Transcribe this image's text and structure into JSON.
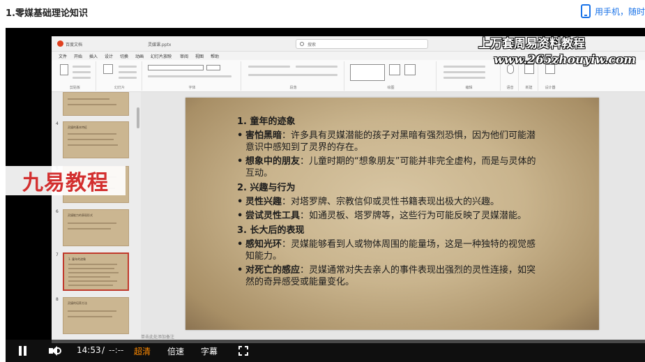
{
  "header": {
    "course_title": "1.零媒基础理论知识",
    "mobile_link": "用手机，随时"
  },
  "ppt": {
    "app_name": "百度文档",
    "file_name": "灵媒课.pptx",
    "search_placeholder": "搜索",
    "menu": [
      "文件",
      "开始",
      "插入",
      "设计",
      "切换",
      "动画",
      "幻灯片放映",
      "审阅",
      "视图",
      "帮助"
    ],
    "ribbon_groups": [
      "剪贴板",
      "幻灯片",
      "字体",
      "段落",
      "绘图",
      "编辑",
      "语音",
      "新建",
      "设计器"
    ],
    "thumbnails": [
      {
        "num": "",
        "title": ""
      },
      {
        "num": "4",
        "title": "灵媒的基本特征"
      },
      {
        "num": "5",
        "title": ""
      },
      {
        "num": "6",
        "title": "灵媒能力的表现形式"
      },
      {
        "num": "7",
        "title": "1. 童年的迹象"
      },
      {
        "num": "8",
        "title": "灵媒的培养方法"
      }
    ],
    "notes_stub": "单击此处添加备注"
  },
  "slide": {
    "sections": [
      {
        "heading": "1. 童年的迹象",
        "bullets": [
          {
            "label": "害怕黑暗",
            "text": "：许多具有灵媒潜能的孩子对黑暗有强烈恐惧，因为他们可能潜意识中感知到了灵界的存在。"
          },
          {
            "label": "想象中的朋友",
            "text": "：儿童时期的“想象朋友”可能并非完全虚构，而是与灵体的互动。"
          }
        ]
      },
      {
        "heading": "2. 兴趣与行为",
        "bullets": [
          {
            "label": "灵性兴趣",
            "text": "：对塔罗牌、宗教信仰或灵性书籍表现出极大的兴趣。"
          },
          {
            "label": "尝试灵性工具",
            "text": "：如通灵板、塔罗牌等，这些行为可能反映了灵媒潜能。"
          }
        ]
      },
      {
        "heading": "3. 长大后的表现",
        "bullets": [
          {
            "label": "感知光环",
            "text": "：灵媒能够看到人或物体周围的能量场，这是一种独特的视觉感知能力。"
          },
          {
            "label": "对死亡的感应",
            "text": "：灵媒通常对失去亲人的事件表现出强烈的灵性连接，如突然的奇异感受或能量变化。"
          }
        ]
      }
    ]
  },
  "watermarks": {
    "top": "上万套周易资料教程",
    "url": "www.265zhouyiw.com",
    "brand": "九易教程"
  },
  "controls": {
    "time_current": "14:53",
    "time_sep": "/",
    "time_total": "--:--",
    "quality": "超清",
    "speed": "倍速",
    "subtitle": "字幕"
  }
}
